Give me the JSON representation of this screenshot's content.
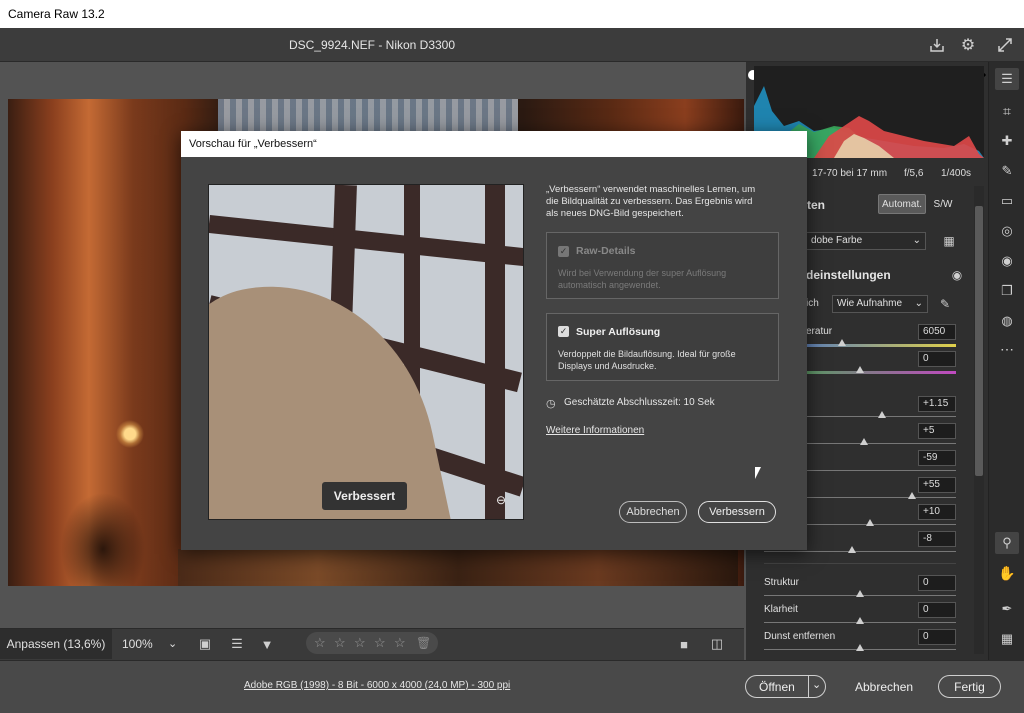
{
  "window": {
    "title": "Camera Raw 13.2"
  },
  "file": {
    "name": "DSC_9924.NEF - Nikon D3300"
  },
  "header_icons": [
    "save-icon",
    "gear-icon",
    "fullscreen-icon"
  ],
  "camera_info": {
    "lens": "17-70 bei 17 mm",
    "aperture": "f/5,6",
    "shutter": "1/400s"
  },
  "panel": {
    "section_fragment": "ten",
    "auto_label": "Automat.",
    "bw_label": "S/W",
    "profile_value": "dobe Farbe",
    "basic_fragment": "deinstellungen",
    "wb_label_fragment": "ich",
    "wb_value": "Wie Aufnahme",
    "temp_label_fragment": "eratur",
    "temp_value": "6050",
    "tint_value": "0",
    "exposure_value": "+1.15",
    "contrast_value": "+5",
    "highlights_value": "-59",
    "shadows_value": "+55",
    "whites_value": "+10",
    "blacks_value": "-8",
    "texture_label": "Struktur",
    "texture_value": "0",
    "clarity_label": "Klarheit",
    "clarity_value": "0",
    "dehaze_label": "Dunst entfernen",
    "dehaze_value": "0"
  },
  "bottom": {
    "fit_label": "Anpassen (13,6%)",
    "zoom_value": "100%",
    "stars": [
      "☆",
      "☆",
      "☆",
      "☆",
      "☆"
    ]
  },
  "footer": {
    "color_info": "Adobe RGB (1998) - 8 Bit - 6000 x 4000 (24,0 MP) - 300 ppi",
    "open_label": "Öffnen",
    "cancel_label": "Abbrechen",
    "done_label": "Fertig"
  },
  "dialog": {
    "title": "Vorschau für „Verbessern“",
    "description": "„Verbessern“ verwendet maschinelles Lernen, um die Bildqualität zu verbessern. Das Ergebnis wird als neues DNG-Bild gespeichert.",
    "raw_label": "Raw-Details",
    "raw_desc": "Wird bei Verwendung der super Auflösung automatisch angewendet.",
    "super_label": "Super Auflösung",
    "super_desc": "Verdoppelt die Bildauflösung. Ideal für große Displays und Ausdrucke.",
    "time_label": "Geschätzte Abschlusszeit: 10 Sek",
    "more_info": "Weitere Informationen",
    "preview_badge": "Verbessert",
    "cancel_label": "Abbrechen",
    "enhance_label": "Verbessern"
  }
}
